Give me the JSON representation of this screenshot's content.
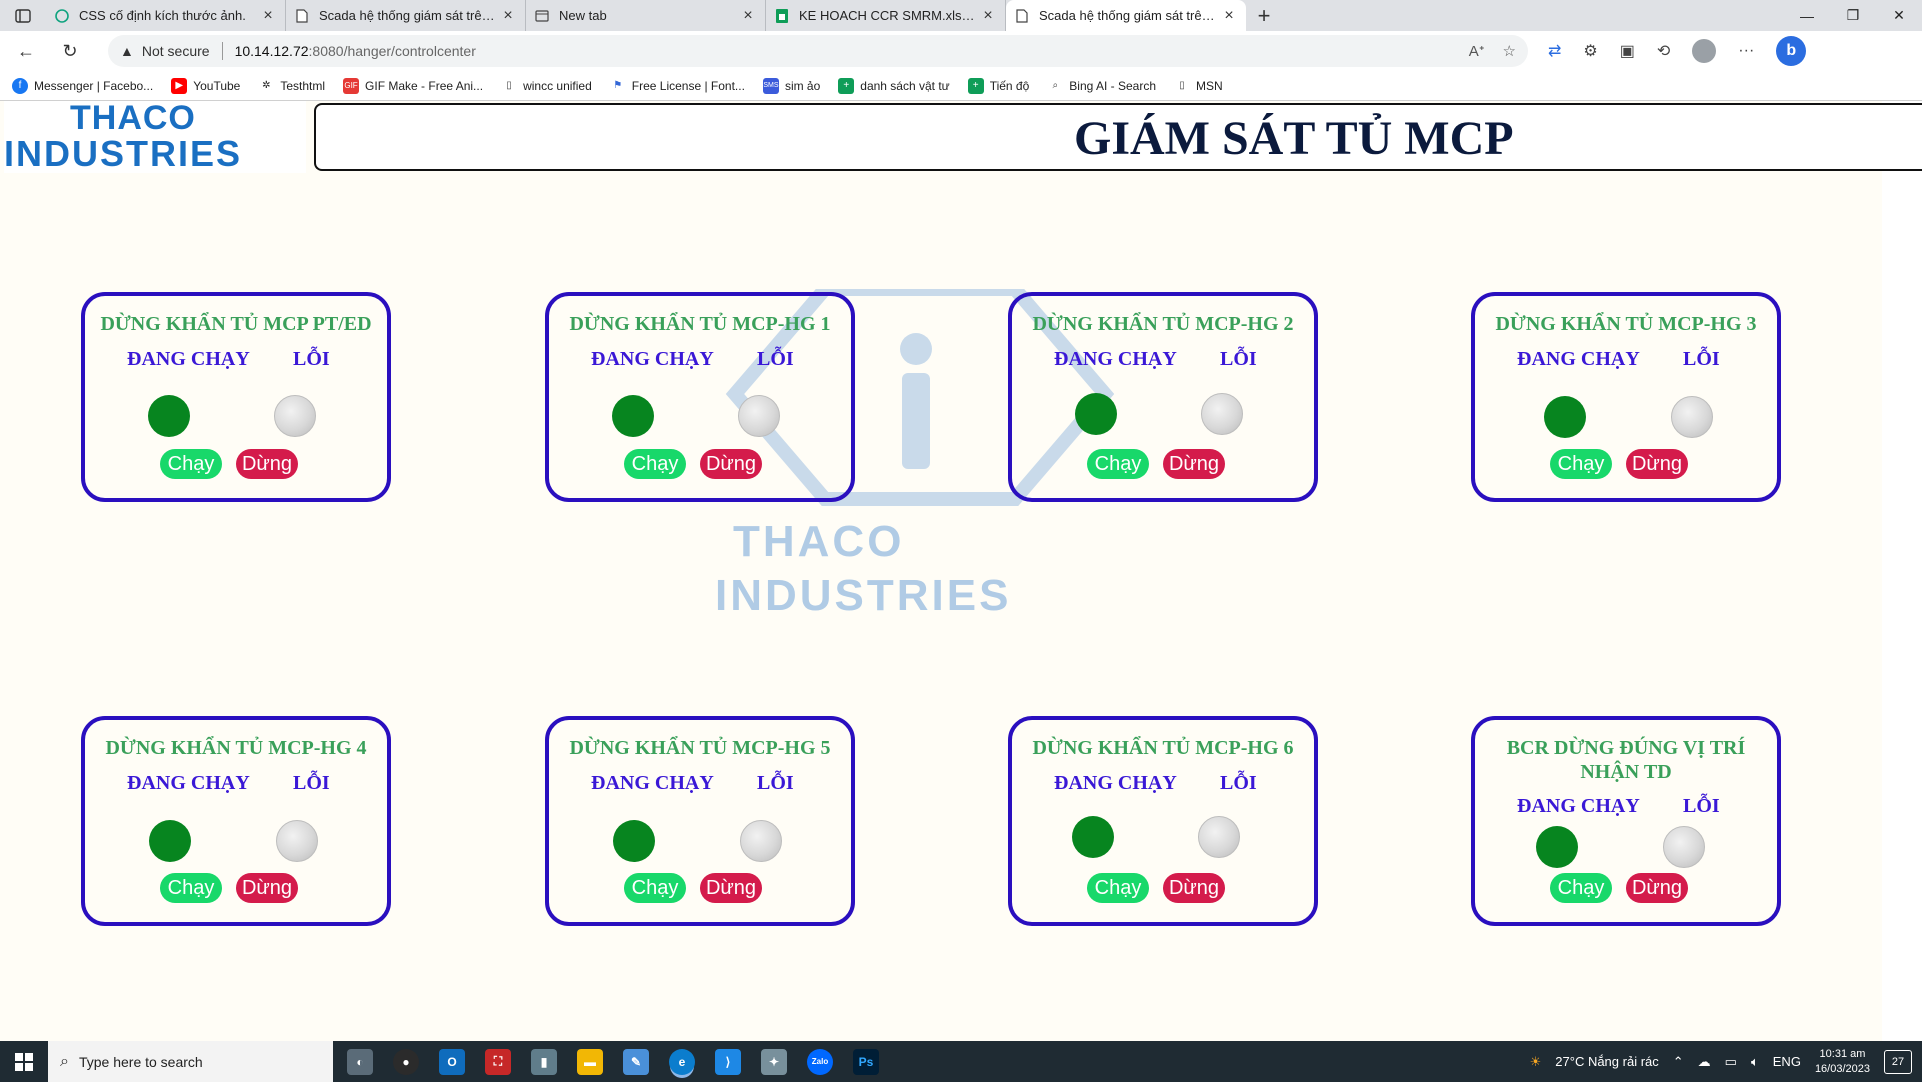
{
  "browser": {
    "tabs": [
      {
        "title": "CSS cố định kích thước ảnh.",
        "icon": "chatgpt-icon",
        "active": false
      },
      {
        "title": "Scada hệ thống giám sát trên int",
        "icon": "page-icon",
        "active": false
      },
      {
        "title": "New tab",
        "icon": "newtab-icon",
        "active": false
      },
      {
        "title": "KE HOACH CCR SMRM.xlsx - Goo",
        "icon": "sheets-icon",
        "active": false
      },
      {
        "title": "Scada hệ thống giám sát trên int",
        "icon": "page-icon",
        "active": true
      }
    ],
    "address": {
      "security": "Not secure",
      "host": "10.14.12.72",
      "path": ":8080/hanger/controlcenter"
    },
    "bookmarks": [
      {
        "label": "Messenger | Facebo...",
        "icon": "facebook-icon",
        "color": "#1877f2"
      },
      {
        "label": "YouTube",
        "icon": "youtube-icon",
        "color": "#ff0000"
      },
      {
        "label": "Testhtml",
        "icon": "openai-icon",
        "color": "#222222"
      },
      {
        "label": "GIF Make - Free Ani...",
        "icon": "gif-icon",
        "color": "#e53935"
      },
      {
        "label": "wincc unified",
        "icon": "page-icon",
        "color": "#ffffff"
      },
      {
        "label": "Free License | Font...",
        "icon": "flag-icon",
        "color": "#3367d6"
      },
      {
        "label": "sim ảo",
        "icon": "sms-icon",
        "color": "#3b5bdb"
      },
      {
        "label": "danh sách vật tư",
        "icon": "sheets-icon",
        "color": "#0f9d58"
      },
      {
        "label": "Tiến độ",
        "icon": "sheets-icon",
        "color": "#0f9d58"
      },
      {
        "label": "Bing AI - Search",
        "icon": "search-icon",
        "color": "#ffffff"
      },
      {
        "label": "MSN",
        "icon": "page-icon",
        "color": "#ffffff"
      }
    ]
  },
  "header": {
    "logo_line1": "THACO",
    "logo_line2": "INDUSTRIES",
    "title": "GIÁM SÁT TỦ MCP"
  },
  "watermark": {
    "line1": "THACO",
    "line2": "INDUSTRIES"
  },
  "labels": {
    "running": "ĐANG CHẠY",
    "error": "LỖI",
    "run_button": "Chạy",
    "stop_button": "Dừng"
  },
  "panels": [
    {
      "title": "DỪNG KHẨN TỦ MCP PT/ED",
      "running": true,
      "error": false
    },
    {
      "title": "DỪNG KHẨN TỦ MCP-HG 1",
      "running": true,
      "error": false
    },
    {
      "title": "DỪNG KHẨN TỦ MCP-HG 2",
      "running": true,
      "error": false
    },
    {
      "title": "DỪNG KHẨN TỦ MCP-HG 3",
      "running": true,
      "error": false
    },
    {
      "title": "DỪNG KHẨN TỦ MCP-HG 4",
      "running": true,
      "error": false
    },
    {
      "title": "DỪNG KHẨN TỦ MCP-HG 5",
      "running": true,
      "error": false
    },
    {
      "title": "DỪNG KHẨN TỦ MCP-HG 6",
      "running": true,
      "error": false
    },
    {
      "title": "BCR DỪNG ĐÚNG VỊ TRÍ NHẬN TD",
      "running": true,
      "error": false
    }
  ],
  "colors": {
    "panel_border": "#2a0fbf",
    "panel_title": "#3aa05a",
    "status_label": "#3a18d6",
    "led_on": "#07851f",
    "run_button": "#18d86a",
    "stop_button": "#d41b4b"
  },
  "taskbar": {
    "search_placeholder": "Type here to search",
    "weather": "27°C  Nắng rải rác",
    "language": "ENG",
    "time": "10:31 am",
    "date": "16/03/2023",
    "notifications": "27"
  }
}
